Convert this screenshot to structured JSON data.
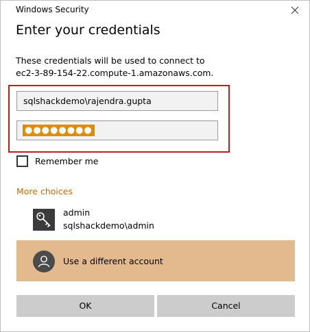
{
  "window": {
    "title": "Windows Security"
  },
  "dialog": {
    "heading": "Enter your credentials",
    "description_line1": "These credentials will be used to connect to",
    "description_line2": "ec2-3-89-154-22.compute-1.amazonaws.com."
  },
  "form": {
    "username_value": "sqlshackdemo\\rajendra.gupta",
    "password_mask": "●●●●●●●●",
    "remember_label": "Remember me",
    "remember_checked": false
  },
  "more_choices": {
    "label": "More choices",
    "accounts": [
      {
        "name": "admin",
        "domain_user": "sqlshackdemo\\admin",
        "icon": "key-icon"
      }
    ],
    "different_account_label": "Use a different account",
    "different_account_icon": "user-avatar-icon"
  },
  "buttons": {
    "ok_label": "OK",
    "cancel_label": "Cancel"
  },
  "colors": {
    "accent_orange": "#c46c00",
    "password_highlight": "#e08b00",
    "selected_tile": "#e3ba8d",
    "highlight_border": "#b32121",
    "button_bg": "#cccccc"
  }
}
